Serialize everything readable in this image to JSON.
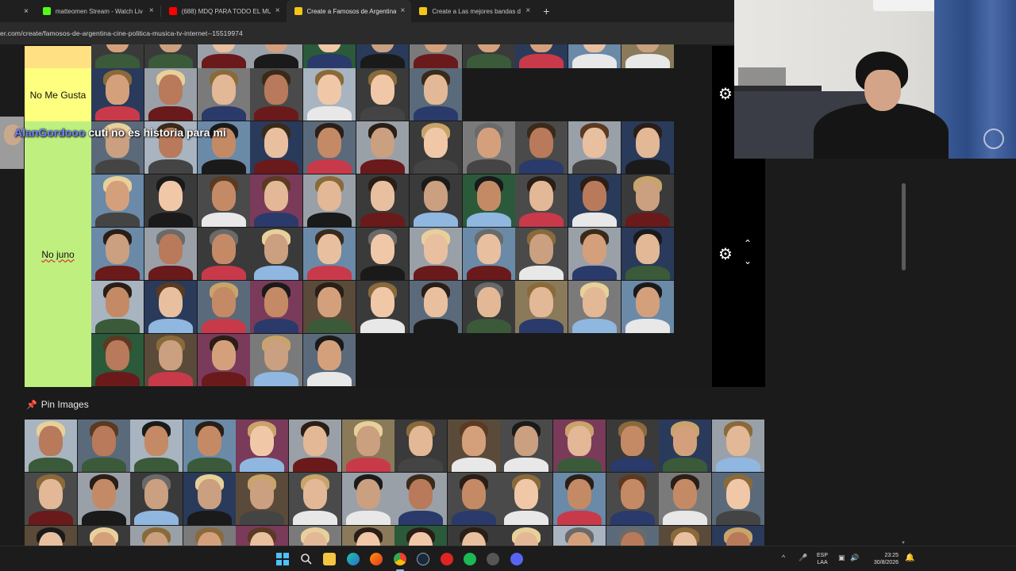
{
  "browser": {
    "tabs": [
      {
        "label": "matteomen Stream - Watch Liv",
        "favicon_color": "#53fc18",
        "active": false
      },
      {
        "label": "(688) MDQ PARA TODO EL MU",
        "favicon_color": "#ff0000",
        "active": false
      },
      {
        "label": "Create a Famosos de Argentina",
        "favicon_color": "#f5c518",
        "active": true
      },
      {
        "label": "Create a Las mejores bandas de",
        "favicon_color": "#f5c518",
        "active": false
      }
    ],
    "close_glyph": "×",
    "new_tab_glyph": "+",
    "url": "er.com/create/famosos-de-argentina-cine-politica-musica-tv-internet--15519974"
  },
  "tiers": [
    {
      "label": "",
      "color": "#ffe082",
      "rows": 1,
      "count": 11
    },
    {
      "label": "No Me Gusta",
      "color": "#ffff7f",
      "rows": 1,
      "count": 7
    },
    {
      "label": "No juno",
      "color": "#bff07f",
      "rows": 5,
      "count": 49
    }
  ],
  "chat_overlay": {
    "user": "AlanGordooo",
    "message": "cuti no es historia para mi"
  },
  "pin_images": {
    "label": "Pin Images",
    "icon": "pin-icon",
    "count": 42
  },
  "controls": {
    "gear_glyph": "⚙",
    "up_glyph": "⌃",
    "down_glyph": "⌄"
  },
  "taskbar": {
    "lang_line1": "ESP",
    "lang_line2": "LAA",
    "time": "23:25",
    "date": "30/8/2026",
    "tray_caret": "^"
  },
  "palette": {
    "skin": [
      "#e2b896",
      "#d4a07c",
      "#c48a66",
      "#f0c8a8",
      "#b87a5a",
      "#e8c0a0",
      "#caa080"
    ],
    "hair": [
      "#2a1e16",
      "#5a3a22",
      "#1a1a1a",
      "#8a6a3a",
      "#c9a46a",
      "#3a2a1a",
      "#e8d09a",
      "#6a6a6a"
    ],
    "bg": [
      "#4a4a4a",
      "#7a7a7a",
      "#2a3a5a",
      "#5a6a7a",
      "#8a7a5a",
      "#3a3a3a",
      "#6a8aa8",
      "#9aa0a8",
      "#2a5a3a",
      "#7a3a5a",
      "#5a4a3a",
      "#a8b4c0"
    ],
    "cloth": [
      "#1a1a1a",
      "#2a3a6a",
      "#e8e8e8",
      "#6a1a1a",
      "#3a5a3a",
      "#8fb7e0",
      "#444444",
      "#c83a4a"
    ]
  }
}
